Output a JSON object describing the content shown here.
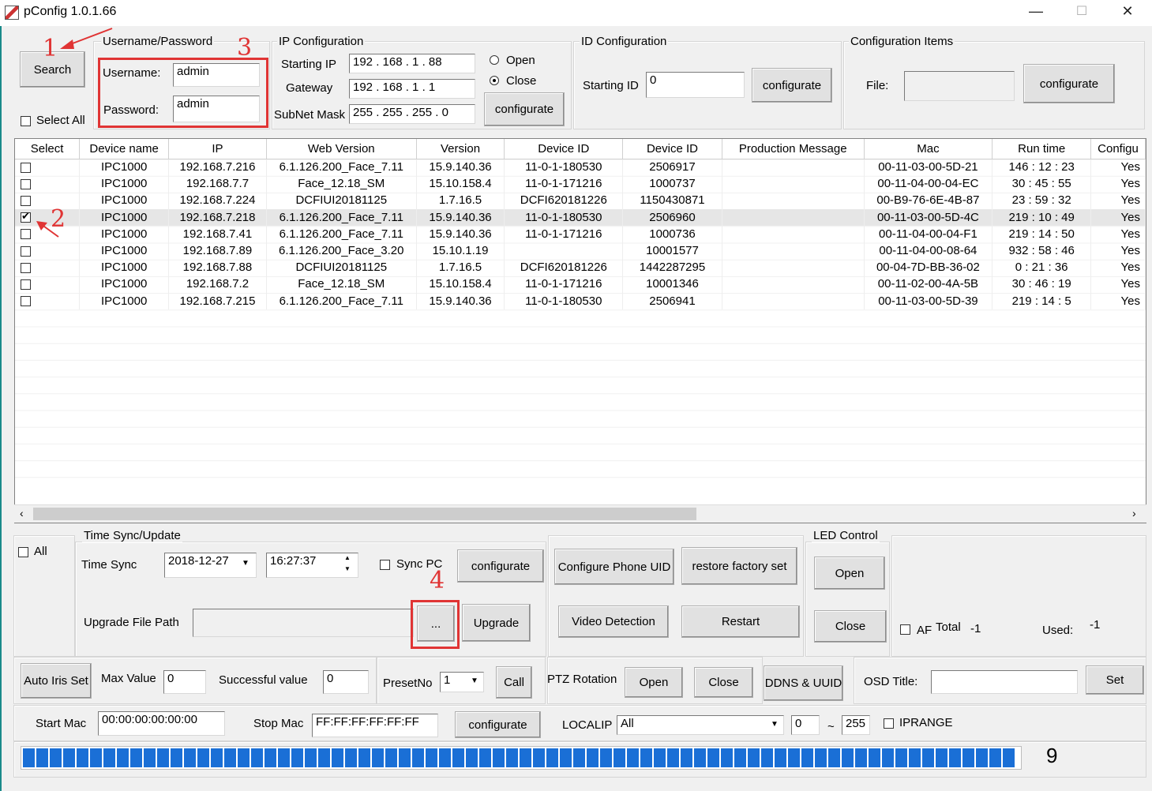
{
  "window": {
    "title": "pConfig  1.0.1.66"
  },
  "top": {
    "search_label": "Search",
    "select_all_label": "Select All",
    "userpass_group": "Username/Password",
    "username_label": "Username:",
    "username_value": "admin",
    "password_label": "Password:",
    "password_value": "admin",
    "ip_group": "IP Configuration",
    "starting_ip_label": "Starting IP",
    "starting_ip": "192 . 168 .   1  .  88",
    "gateway_label": "Gateway",
    "gateway": "192 . 168 .   1  .   1",
    "subnet_label": "SubNet Mask",
    "subnet": "255 . 255 . 255 .   0",
    "open_label": "Open",
    "close_label": "Close",
    "ip_configurate": "configurate",
    "id_group": "ID Configuration",
    "starting_id_label": "Starting ID",
    "starting_id_value": "0",
    "id_configurate": "configurate",
    "items_group": "Configuration Items",
    "file_label": "File:",
    "file_value": "",
    "items_configurate": "configurate"
  },
  "table": {
    "columns": [
      "Select",
      "Device name",
      "IP",
      "Web Version",
      "Version",
      "Device ID",
      "Device ID",
      "Production Message",
      "Mac",
      "Run time",
      "Configu"
    ],
    "rows": [
      {
        "checked": false,
        "name": "IPC1000",
        "ip": "192.168.7.216",
        "web": "6.1.126.200_Face_7.11",
        "ver": "15.9.140.36",
        "devid": "11-0-1-180530",
        "devid2": "2506917",
        "prod": "",
        "mac": "00-11-03-00-5D-21",
        "run": "146 : 12 : 23",
        "conf": "Yes"
      },
      {
        "checked": false,
        "name": "IPC1000",
        "ip": "192.168.7.7",
        "web": "Face_12.18_SM",
        "ver": "15.10.158.4",
        "devid": "11-0-1-171216",
        "devid2": "1000737",
        "prod": "",
        "mac": "00-11-04-00-04-EC",
        "run": "30 : 45 : 55",
        "conf": "Yes"
      },
      {
        "checked": false,
        "name": "IPC1000",
        "ip": "192.168.7.224",
        "web": "DCFIUI20181125",
        "ver": "1.7.16.5",
        "devid": "DCFI620181226",
        "devid2": "1150430871",
        "prod": "",
        "mac": "00-B9-76-6E-4B-87",
        "run": "23 : 59 : 32",
        "conf": "Yes"
      },
      {
        "checked": true,
        "name": "IPC1000",
        "ip": "192.168.7.218",
        "web": "6.1.126.200_Face_7.11",
        "ver": "15.9.140.36",
        "devid": "11-0-1-180530",
        "devid2": "2506960",
        "prod": "",
        "mac": "00-11-03-00-5D-4C",
        "run": "219 : 10 : 49",
        "conf": "Yes"
      },
      {
        "checked": false,
        "name": "IPC1000",
        "ip": "192.168.7.41",
        "web": "6.1.126.200_Face_7.11",
        "ver": "15.9.140.36",
        "devid": "11-0-1-171216",
        "devid2": "1000736",
        "prod": "",
        "mac": "00-11-04-00-04-F1",
        "run": "219 : 14 : 50",
        "conf": "Yes"
      },
      {
        "checked": false,
        "name": "IPC1000",
        "ip": "192.168.7.89",
        "web": "6.1.126.200_Face_3.20",
        "ver": "15.10.1.19",
        "devid": "",
        "devid2": "10001577",
        "prod": "",
        "mac": "00-11-04-00-08-64",
        "run": "932 : 58 : 46",
        "conf": "Yes"
      },
      {
        "checked": false,
        "name": "IPC1000",
        "ip": "192.168.7.88",
        "web": "DCFIUI20181125",
        "ver": "1.7.16.5",
        "devid": "DCFI620181226",
        "devid2": "1442287295",
        "prod": "",
        "mac": "00-04-7D-BB-36-02",
        "run": "0 : 21 : 36",
        "conf": "Yes"
      },
      {
        "checked": false,
        "name": "IPC1000",
        "ip": "192.168.7.2",
        "web": "Face_12.18_SM",
        "ver": "15.10.158.4",
        "devid": "11-0-1-171216",
        "devid2": "10001346",
        "prod": "",
        "mac": "00-11-02-00-4A-5B",
        "run": "30 : 46 : 19",
        "conf": "Yes"
      },
      {
        "checked": false,
        "name": "IPC1000",
        "ip": "192.168.7.215",
        "web": "6.1.126.200_Face_7.11",
        "ver": "15.9.140.36",
        "devid": "11-0-1-180530",
        "devid2": "2506941",
        "prod": "",
        "mac": "00-11-03-00-5D-39",
        "run": "219 : 14 : 5",
        "conf": "Yes"
      }
    ]
  },
  "bottom": {
    "all_label": "All",
    "time_group": "Time Sync/Update",
    "time_sync_label": "Time Sync",
    "date_value": "2018-12-27",
    "time_value": "16:27:37",
    "sync_pc_label": "Sync PC",
    "time_configurate": "configurate",
    "upgrade_path_label": "Upgrade File Path",
    "upgrade_path_value": "",
    "browse_label": "...",
    "upgrade_label": "Upgrade",
    "phone_uid_label": "Configure Phone UID",
    "restore_label": "restore factory set",
    "video_detection_label": "Video Detection",
    "restart_label": "Restart",
    "led_group": "LED Control",
    "led_open": "Open",
    "led_close": "Close",
    "af_label": "AF",
    "total_label": "Total",
    "total_value": "-1",
    "used_label": "Used:",
    "used_value": "-1",
    "auto_iris_label": "Auto Iris Set",
    "max_value_label": "Max Value",
    "max_value": "0",
    "success_label": "Successful value",
    "success_value": "0",
    "preset_label": "PresetNo",
    "preset_value": "1",
    "call_label": "Call",
    "ptz_label": "PTZ Rotation",
    "ptz_open": "Open",
    "ptz_close": "Close",
    "ddns_label": "DDNS & UUID",
    "osd_label": "OSD Title:",
    "osd_value": "",
    "set_label": "Set",
    "start_mac_label": "Start Mac",
    "start_mac_value": "00:00:00:00:00:00",
    "stop_mac_label": "Stop Mac",
    "stop_mac_value": "FF:FF:FF:FF:FF:FF",
    "mac_configurate": "configurate",
    "localip_label": "LOCALIP",
    "localip_value": "All",
    "range_from": "0",
    "range_sep": "~",
    "range_to": "255",
    "iprange_label": "IPRANGE",
    "progress_fraction": 0.997,
    "count_value": "9"
  },
  "annotations": {
    "a1": "1",
    "a2": "2",
    "a3": "3",
    "a4": "4"
  },
  "colors": {
    "annotation": "#e03434",
    "progress": "#1a6fd6"
  },
  "icons": {
    "minimize": "minimize-icon",
    "maximize": "maximize-icon",
    "close": "close-icon"
  }
}
